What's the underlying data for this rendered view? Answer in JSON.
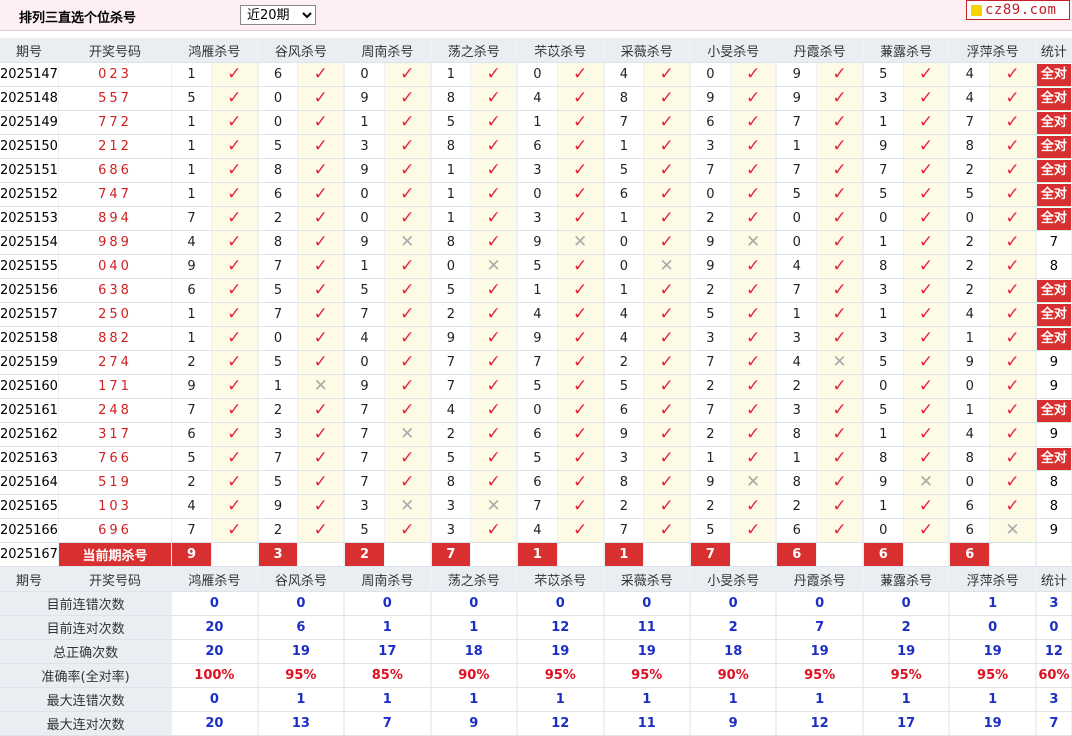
{
  "title": "排列三直选个位杀号",
  "period_selected": "近20期",
  "logo_text": "cz89.com",
  "headers": [
    "期号",
    "开奖号码",
    "鸿雁杀号",
    "谷风杀号",
    "周南杀号",
    "荡之杀号",
    "芣苡杀号",
    "采薇杀号",
    "小旻杀号",
    "丹霞杀号",
    "蒹露杀号",
    "浮萍杀号",
    "统计"
  ],
  "rows": [
    {
      "issue": "2025147",
      "draw": "023",
      "kills": [
        "1",
        "6",
        "0",
        "1",
        "0",
        "4",
        "0",
        "9",
        "5",
        "4"
      ],
      "marks": [
        1,
        1,
        1,
        1,
        1,
        1,
        1,
        1,
        1,
        1
      ],
      "stat": "全对"
    },
    {
      "issue": "2025148",
      "draw": "557",
      "kills": [
        "5",
        "0",
        "9",
        "8",
        "4",
        "8",
        "9",
        "9",
        "3",
        "4"
      ],
      "marks": [
        1,
        1,
        1,
        1,
        1,
        1,
        1,
        1,
        1,
        1
      ],
      "stat": "全对"
    },
    {
      "issue": "2025149",
      "draw": "772",
      "kills": [
        "1",
        "0",
        "1",
        "5",
        "1",
        "7",
        "6",
        "7",
        "1",
        "7"
      ],
      "marks": [
        1,
        1,
        1,
        1,
        1,
        1,
        1,
        1,
        1,
        1
      ],
      "stat": "全对"
    },
    {
      "issue": "2025150",
      "draw": "212",
      "kills": [
        "1",
        "5",
        "3",
        "8",
        "6",
        "1",
        "3",
        "1",
        "9",
        "8"
      ],
      "marks": [
        1,
        1,
        1,
        1,
        1,
        1,
        1,
        1,
        1,
        1
      ],
      "stat": "全对"
    },
    {
      "issue": "2025151",
      "draw": "686",
      "kills": [
        "1",
        "8",
        "9",
        "1",
        "3",
        "5",
        "7",
        "7",
        "7",
        "2"
      ],
      "marks": [
        1,
        1,
        1,
        1,
        1,
        1,
        1,
        1,
        1,
        1
      ],
      "stat": "全对"
    },
    {
      "issue": "2025152",
      "draw": "747",
      "kills": [
        "1",
        "6",
        "0",
        "1",
        "0",
        "6",
        "0",
        "5",
        "5",
        "5"
      ],
      "marks": [
        1,
        1,
        1,
        1,
        1,
        1,
        1,
        1,
        1,
        1
      ],
      "stat": "全对"
    },
    {
      "issue": "2025153",
      "draw": "894",
      "kills": [
        "7",
        "2",
        "0",
        "1",
        "3",
        "1",
        "2",
        "0",
        "0",
        "0"
      ],
      "marks": [
        1,
        1,
        1,
        1,
        1,
        1,
        1,
        1,
        1,
        1
      ],
      "stat": "全对"
    },
    {
      "issue": "2025154",
      "draw": "989",
      "kills": [
        "4",
        "8",
        "9",
        "8",
        "9",
        "0",
        "9",
        "0",
        "1",
        "2"
      ],
      "marks": [
        1,
        1,
        0,
        1,
        0,
        1,
        0,
        1,
        1,
        1
      ],
      "stat": "7"
    },
    {
      "issue": "2025155",
      "draw": "040",
      "kills": [
        "9",
        "7",
        "1",
        "0",
        "5",
        "0",
        "9",
        "4",
        "8",
        "2"
      ],
      "marks": [
        1,
        1,
        1,
        0,
        1,
        0,
        1,
        1,
        1,
        1
      ],
      "stat": "8"
    },
    {
      "issue": "2025156",
      "draw": "638",
      "kills": [
        "6",
        "5",
        "5",
        "5",
        "1",
        "1",
        "2",
        "7",
        "3",
        "2"
      ],
      "marks": [
        1,
        1,
        1,
        1,
        1,
        1,
        1,
        1,
        1,
        1
      ],
      "stat": "全对"
    },
    {
      "issue": "2025157",
      "draw": "250",
      "kills": [
        "1",
        "7",
        "7",
        "2",
        "4",
        "4",
        "5",
        "1",
        "1",
        "4"
      ],
      "marks": [
        1,
        1,
        1,
        1,
        1,
        1,
        1,
        1,
        1,
        1
      ],
      "stat": "全对"
    },
    {
      "issue": "2025158",
      "draw": "882",
      "kills": [
        "1",
        "0",
        "4",
        "9",
        "9",
        "4",
        "3",
        "3",
        "3",
        "1"
      ],
      "marks": [
        1,
        1,
        1,
        1,
        1,
        1,
        1,
        1,
        1,
        1
      ],
      "stat": "全对"
    },
    {
      "issue": "2025159",
      "draw": "274",
      "kills": [
        "2",
        "5",
        "0",
        "7",
        "7",
        "2",
        "7",
        "4",
        "5",
        "9"
      ],
      "marks": [
        1,
        1,
        1,
        1,
        1,
        1,
        1,
        0,
        1,
        1
      ],
      "stat": "9"
    },
    {
      "issue": "2025160",
      "draw": "171",
      "kills": [
        "9",
        "1",
        "9",
        "7",
        "5",
        "5",
        "2",
        "2",
        "0",
        "0"
      ],
      "marks": [
        1,
        0,
        1,
        1,
        1,
        1,
        1,
        1,
        1,
        1
      ],
      "stat": "9"
    },
    {
      "issue": "2025161",
      "draw": "248",
      "kills": [
        "7",
        "2",
        "7",
        "4",
        "0",
        "6",
        "7",
        "3",
        "5",
        "1"
      ],
      "marks": [
        1,
        1,
        1,
        1,
        1,
        1,
        1,
        1,
        1,
        1
      ],
      "stat": "全对"
    },
    {
      "issue": "2025162",
      "draw": "317",
      "kills": [
        "6",
        "3",
        "7",
        "2",
        "6",
        "9",
        "2",
        "8",
        "1",
        "4"
      ],
      "marks": [
        1,
        1,
        0,
        1,
        1,
        1,
        1,
        1,
        1,
        1
      ],
      "stat": "9"
    },
    {
      "issue": "2025163",
      "draw": "766",
      "kills": [
        "5",
        "7",
        "7",
        "5",
        "5",
        "3",
        "1",
        "1",
        "8",
        "8"
      ],
      "marks": [
        1,
        1,
        1,
        1,
        1,
        1,
        1,
        1,
        1,
        1
      ],
      "stat": "全对"
    },
    {
      "issue": "2025164",
      "draw": "519",
      "kills": [
        "2",
        "5",
        "7",
        "8",
        "6",
        "8",
        "9",
        "8",
        "9",
        "0"
      ],
      "marks": [
        1,
        1,
        1,
        1,
        1,
        1,
        0,
        1,
        0,
        1
      ],
      "stat": "8"
    },
    {
      "issue": "2025165",
      "draw": "103",
      "kills": [
        "4",
        "9",
        "3",
        "3",
        "7",
        "2",
        "2",
        "2",
        "1",
        "6"
      ],
      "marks": [
        1,
        1,
        0,
        0,
        1,
        1,
        1,
        1,
        1,
        1
      ],
      "stat": "8"
    },
    {
      "issue": "2025166",
      "draw": "696",
      "kills": [
        "7",
        "2",
        "5",
        "3",
        "4",
        "7",
        "5",
        "6",
        "0",
        "6"
      ],
      "marks": [
        1,
        1,
        1,
        1,
        1,
        1,
        1,
        1,
        1,
        0
      ],
      "stat": "9"
    }
  ],
  "current": {
    "issue": "2025167",
    "label": "当前期杀号",
    "kills": [
      "9",
      "3",
      "2",
      "7",
      "1",
      "1",
      "7",
      "6",
      "6",
      "6"
    ]
  },
  "stats": [
    {
      "label": "目前连错次数",
      "values": [
        "0",
        "0",
        "0",
        "0",
        "0",
        "0",
        "0",
        "0",
        "0",
        "1"
      ],
      "total": "3",
      "pct": false
    },
    {
      "label": "目前连对次数",
      "values": [
        "20",
        "6",
        "1",
        "1",
        "12",
        "11",
        "2",
        "7",
        "2",
        "0"
      ],
      "total": "0",
      "pct": false
    },
    {
      "label": "总正确次数",
      "values": [
        "20",
        "19",
        "17",
        "18",
        "19",
        "19",
        "18",
        "19",
        "19",
        "19"
      ],
      "total": "12",
      "pct": false
    },
    {
      "label": "准确率(全对率)",
      "values": [
        "100%",
        "95%",
        "85%",
        "90%",
        "95%",
        "95%",
        "90%",
        "95%",
        "95%",
        "95%"
      ],
      "total": "60%",
      "pct": true
    },
    {
      "label": "最大连错次数",
      "values": [
        "0",
        "1",
        "1",
        "1",
        "1",
        "1",
        "1",
        "1",
        "1",
        "1"
      ],
      "total": "3",
      "pct": false
    },
    {
      "label": "最大连对次数",
      "values": [
        "20",
        "13",
        "7",
        "9",
        "12",
        "11",
        "9",
        "12",
        "17",
        "19"
      ],
      "total": "7",
      "pct": false
    }
  ],
  "icons": {
    "correct": "check-icon",
    "wrong": "cross-icon"
  },
  "colors": {
    "accent_red": "#d83030",
    "check_red": "#e6223c",
    "stat_blue": "#1b2fc4",
    "header_bg": "#e9eef3",
    "mark_bg": "#fdfbe6"
  }
}
